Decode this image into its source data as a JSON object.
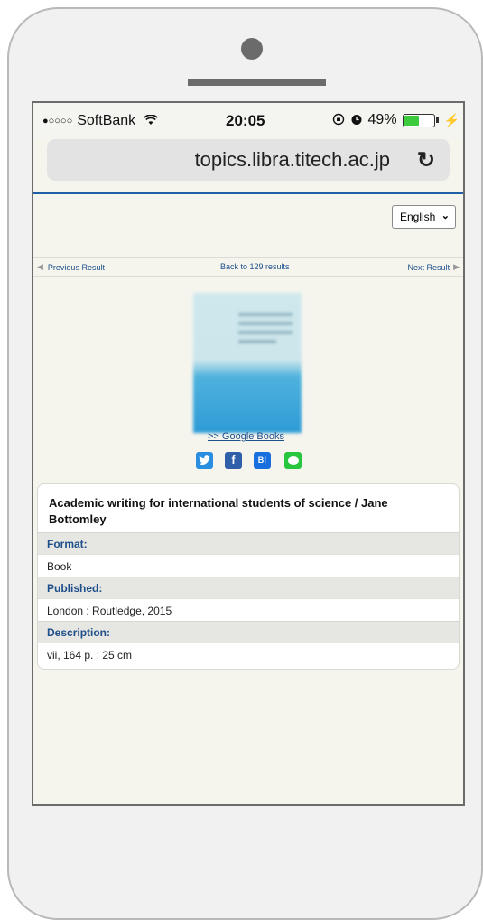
{
  "status_bar": {
    "signal": "●○○○○",
    "carrier": "SoftBank",
    "time": "20:05",
    "battery_percent": "49%",
    "battery_level": 0.49,
    "icons": [
      "wifi-icon",
      "rotation-lock-icon",
      "alarm-icon",
      "battery-icon",
      "charging-bolt-icon"
    ]
  },
  "browser": {
    "url": "topics.libra.titech.ac.jp",
    "reload_icon": "reload-icon"
  },
  "language": {
    "selected": "English"
  },
  "result_nav": {
    "previous": "Previous Result",
    "back": "Back to 129 results",
    "next": "Next Result"
  },
  "cover": {
    "google_books_link": ">> Google Books"
  },
  "social": {
    "twitter": "twitter-icon",
    "facebook": "facebook-icon",
    "hatena": "B!",
    "line": "line-icon"
  },
  "record": {
    "title": "Academic writing for international students of science / Jane Bottomley",
    "fields": [
      {
        "label": "Format:",
        "value": "Book"
      },
      {
        "label": "Published:",
        "value": "London : Routledge, 2015"
      },
      {
        "label": "Description:",
        "value": "vii, 164 p. ; 25 cm"
      }
    ]
  },
  "colors": {
    "link": "#1d4f8a",
    "accent_line": "#1f5fa5",
    "battery": "#3ccb3c"
  }
}
